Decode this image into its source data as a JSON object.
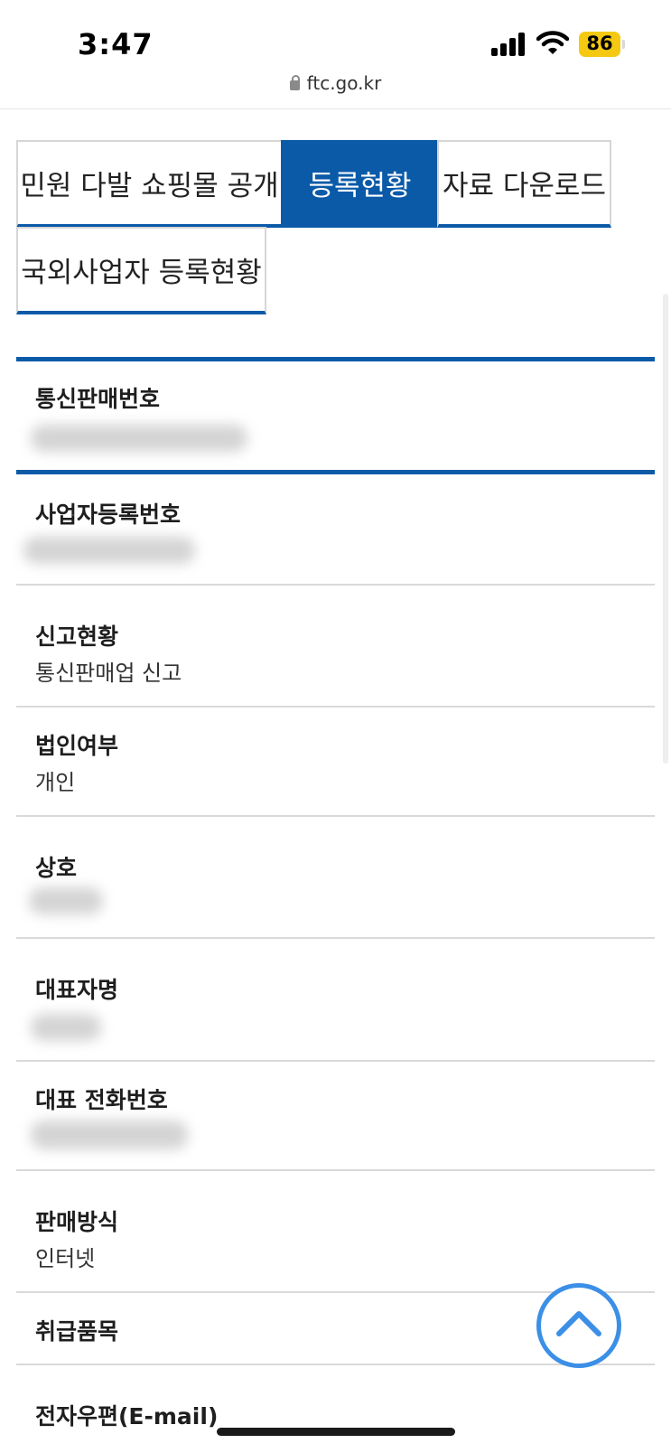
{
  "status": {
    "time": "3:47",
    "battery": "86"
  },
  "browser": {
    "url": "ftc.go.kr"
  },
  "tabs": [
    {
      "label": "민원 다발 쇼핑몰 공개",
      "active": false
    },
    {
      "label": "등록현황",
      "active": true
    },
    {
      "label": "자료 다운로드",
      "active": false
    },
    {
      "label": "국외사업자 등록현황",
      "active": false
    }
  ],
  "fields": [
    {
      "label": "통신판매번호",
      "value": ""
    },
    {
      "label": "사업자등록번호",
      "value": ""
    },
    {
      "label": "신고현황",
      "value": "통신판매업 신고"
    },
    {
      "label": "법인여부",
      "value": "개인"
    },
    {
      "label": "상호",
      "value": ""
    },
    {
      "label": "대표자명",
      "value": ""
    },
    {
      "label": "대표 전화번호",
      "value": ""
    },
    {
      "label": "판매방식",
      "value": "인터넷"
    },
    {
      "label": "취급품목",
      "value": ""
    },
    {
      "label": "전자우편(E-mail)",
      "value": ""
    }
  ],
  "colors": {
    "accent": "#0b5aa8",
    "scroll_button": "#3b8fe6",
    "battery": "#f5c912"
  },
  "icons": {
    "scroll_top": "chevron-up-icon",
    "lock": "lock-icon"
  }
}
